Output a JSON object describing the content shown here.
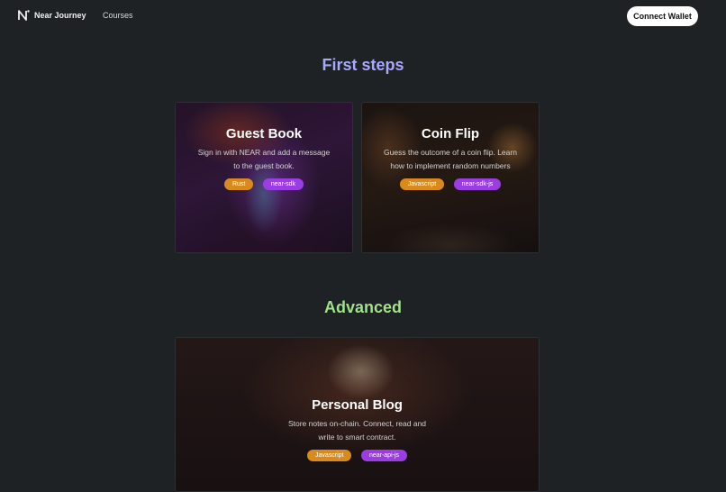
{
  "nav": {
    "brand": "Near Journey",
    "links": [
      "Courses"
    ],
    "connect_label": "Connect Wallet"
  },
  "sections": {
    "first_steps": "First steps",
    "advanced": "Advanced"
  },
  "cards": [
    {
      "title": "Guest Book",
      "description": "Sign in with NEAR and add a message to the guest book.",
      "tags": [
        "Rust",
        "near-sdk"
      ]
    },
    {
      "title": "Coin Flip",
      "description": "Guess the outcome of a coin flip. Learn how to implement random numbers",
      "tags": [
        "Javascript",
        "near-sdk-js"
      ]
    },
    {
      "title": "Personal Blog",
      "description": "Store notes on-chain. Connect, read and write to smart contract.",
      "tags": [
        "Javascript",
        "near-api-js"
      ]
    }
  ],
  "colors": {
    "background": "#1e2224",
    "tag_language": "#d98a1d",
    "tag_sdk": "#9b3de2",
    "first_steps_gradient": [
      "#8fb6ff",
      "#c39cff"
    ],
    "advanced_gradient": [
      "#8cdc8c",
      "#b7ec8a"
    ]
  },
  "icons": {
    "logo": "near-logo-icon"
  }
}
